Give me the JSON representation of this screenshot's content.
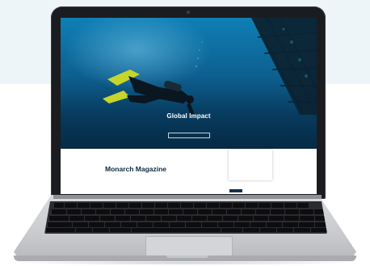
{
  "website": {
    "hero": {
      "title": "Global Impact",
      "subtitle": "",
      "button_label": ""
    },
    "breadcrumb": "",
    "page_title": "Monarch Magazine",
    "body": {
      "paragraph": "",
      "link_text": ""
    },
    "sidebar_card": {
      "title": "",
      "items": [
        "",
        ""
      ]
    }
  },
  "colors": {
    "hero_top": "#0f7fb5",
    "hero_bottom": "#062a44",
    "title_navy": "#0e2a45",
    "laptop_silver": "#c9cacd",
    "bezel": "#1b1c1f"
  }
}
